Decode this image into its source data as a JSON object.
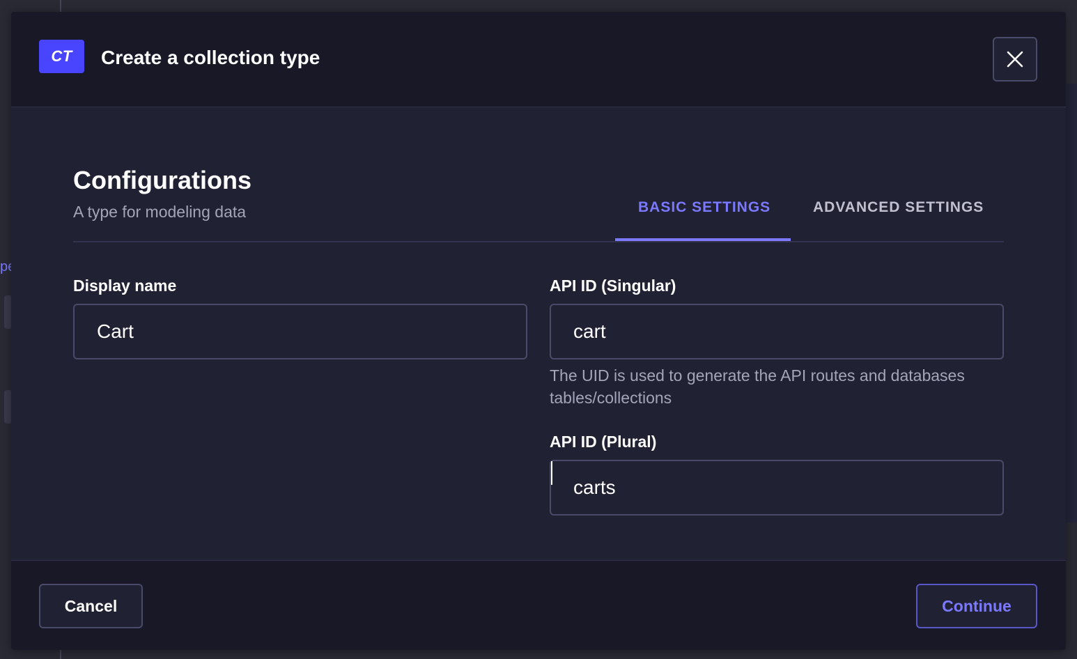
{
  "backdrop": {
    "fragment_text": "pe"
  },
  "modal": {
    "badge": "CT",
    "title": "Create a collection type",
    "close_icon": "close-icon"
  },
  "body": {
    "title": "Configurations",
    "subtitle": "A type for modeling data",
    "tabs": [
      {
        "label": "BASIC SETTINGS",
        "active": true
      },
      {
        "label": "ADVANCED SETTINGS",
        "active": false
      }
    ],
    "fields": {
      "display_name": {
        "label": "Display name",
        "value": "Cart"
      },
      "api_id_singular": {
        "label": "API ID (Singular)",
        "value": "cart",
        "hint": "The UID is used to generate the API routes and databases tables/collections"
      },
      "api_id_plural": {
        "label": "API ID (Plural)",
        "value": "carts"
      }
    }
  },
  "footer": {
    "cancel_label": "Cancel",
    "continue_label": "Continue"
  },
  "colors": {
    "accent": "#4945ff",
    "accent_light": "#7b79ff",
    "modal_bg": "#212134",
    "header_bg": "#181826"
  }
}
